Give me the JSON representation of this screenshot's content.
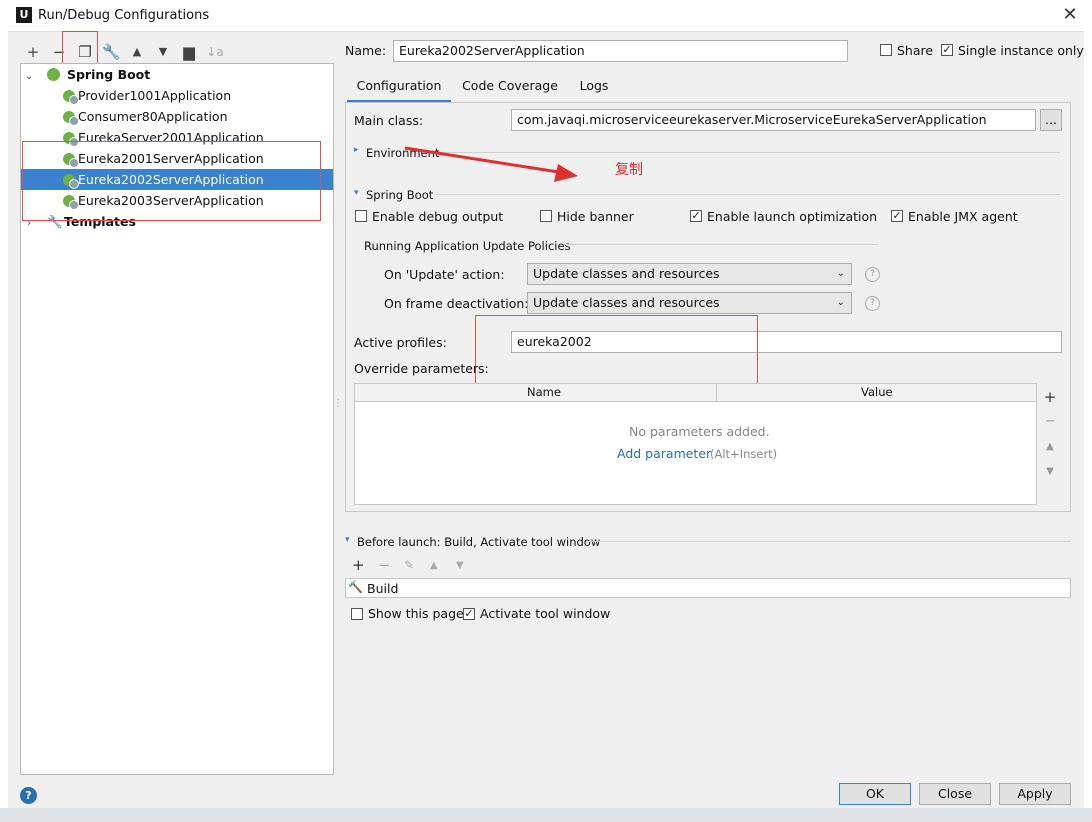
{
  "window": {
    "title": "Run/Debug Configurations",
    "app_icon": "U"
  },
  "toolbar": {
    "icons": [
      "plus-icon",
      "minus-icon",
      "copy-icon",
      "wrench-icon",
      "arrow-up-icon",
      "arrow-down-icon",
      "folder-icon",
      "sort-icon"
    ]
  },
  "tree": {
    "root": "Spring Boot",
    "items": [
      "Provider1001Application",
      "Consumer80Application",
      "EurekaServer2001Application",
      "Eureka2001ServerApplication",
      "Eureka2002ServerApplication",
      "Eureka2003ServerApplication"
    ],
    "templates": "Templates"
  },
  "form": {
    "name_label": "Name:",
    "name_value": "Eureka2002ServerApplication",
    "share_label": "Share",
    "single_instance_label": "Single instance only"
  },
  "tabs": [
    "Configuration",
    "Code Coverage",
    "Logs"
  ],
  "config": {
    "main_class_label": "Main class:",
    "main_class_value": "com.javaqi.microserviceeurekaserver.MicroserviceEurekaServerApplication",
    "browse_label": "...",
    "environment_label": "Environment",
    "annotation": "复制",
    "spring_boot_label": "Spring Boot",
    "enable_debug": "Enable debug output",
    "hide_banner": "Hide banner",
    "enable_launch_opt": "Enable launch optimization",
    "enable_jmx": "Enable JMX agent",
    "update_policies_label": "Running Application Update Policies",
    "on_update_label": "On 'Update' action:",
    "on_update_value": "Update classes and resources",
    "on_frame_label": "On frame deactivation:",
    "on_frame_value": "Update classes and resources",
    "active_profiles_label": "Active profiles:",
    "active_profiles_value": "eureka2002",
    "override_label": "Override parameters:",
    "col_name": "Name",
    "col_value": "Value",
    "no_params": "No parameters added.",
    "add_param": "Add parameter",
    "add_param_shortcut": "(Alt+Insert)"
  },
  "before_launch": {
    "label": "Before launch: Build, Activate tool window",
    "build": "Build",
    "show_page": "Show this page",
    "activate": "Activate tool window"
  },
  "buttons": {
    "ok": "OK",
    "close": "Close",
    "apply": "Apply",
    "help": "?"
  },
  "colors": {
    "selection": "#3a81d0",
    "link": "#2a6db8",
    "annotation": "#e03030",
    "spring": "#6db33f"
  }
}
